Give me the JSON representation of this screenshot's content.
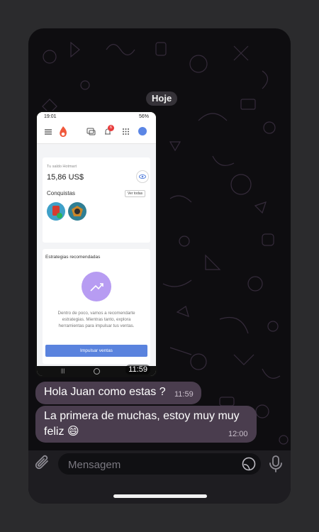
{
  "chat": {
    "date_label": "Hoje",
    "screenshot": {
      "status_time": "19:01",
      "status_battery": "56%",
      "notification_count": "6",
      "balance_label": "Tu saldo Hotmart",
      "balance": "15,86 US$",
      "achievements_label": "Conquistas",
      "see_all": "Ver todas",
      "strategies_title": "Estrategias recomendadas",
      "strategies_text": "Dentro de poco, vamos a recomendarte estrategias. Mientras tanto, explora herramientas para impulsar tus ventas.",
      "boost_button": "Impulsar ventas",
      "time": "11:59"
    },
    "messages": [
      {
        "text": "Hola Juan como estas ?",
        "time": "11:59"
      },
      {
        "text": "La primera de muchas, estoy muy muy feliz 😄",
        "time": "12:00"
      }
    ]
  },
  "composer": {
    "placeholder": "Mensagem",
    "attach_icon": "paperclip-icon",
    "sticker_icon": "sticker-icon",
    "mic_icon": "microphone-icon"
  },
  "colors": {
    "bubble": "#4a3d4e",
    "wallpaper": "#0e0d10",
    "accent_button": "#5a83de",
    "strategy_circle": "#b79cf2"
  }
}
